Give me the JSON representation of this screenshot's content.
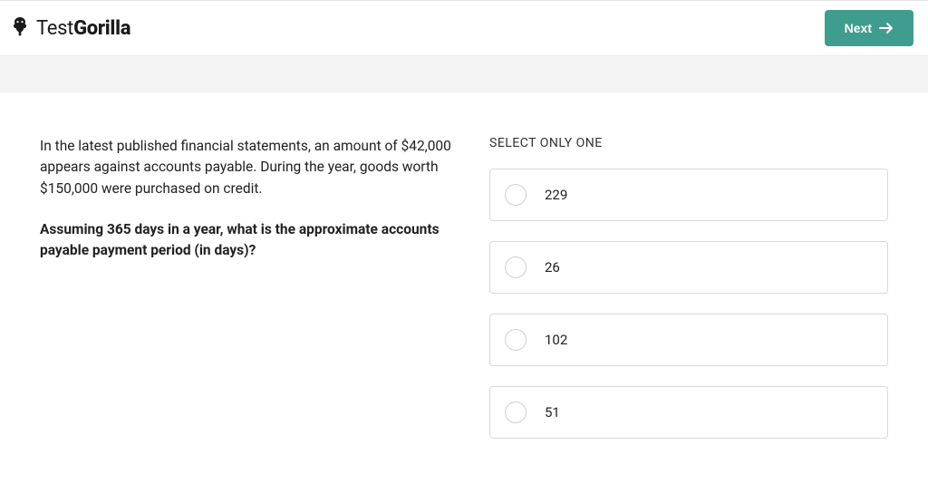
{
  "brand": {
    "name_thin": "Test",
    "name_bold": "Gorilla"
  },
  "header": {
    "next_label": "Next"
  },
  "question": {
    "context": "In the latest published financial statements, an amount of $42,000 appears against accounts payable. During the year, goods worth $150,000 were purchased on credit.",
    "prompt": "Assuming 365 days in a year, what is the approximate accounts payable payment period (in days)?"
  },
  "answers": {
    "instruction": "SELECT ONLY ONE",
    "options": [
      "229",
      "26",
      "102",
      "51"
    ]
  }
}
